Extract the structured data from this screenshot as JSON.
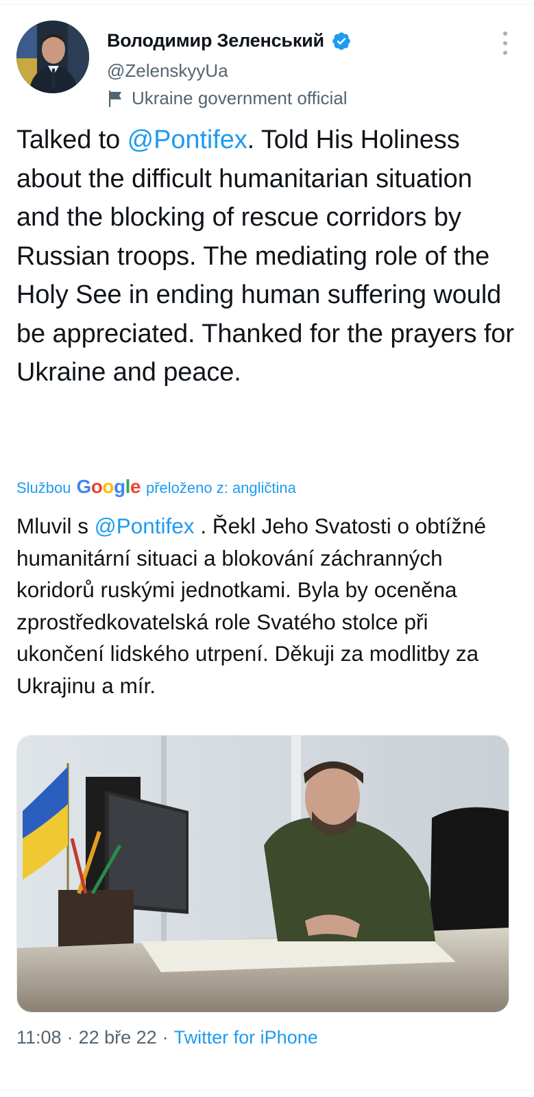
{
  "author": {
    "display_name": "Володимир Зеленський",
    "handle": "@ZelenskyyUa",
    "label": "Ukraine government official",
    "verified": true
  },
  "icons": {
    "verified": "verified-badge-icon",
    "label": "flag-icon",
    "more": "more-vertical-icon"
  },
  "tweet": {
    "prefix": "Talked to ",
    "mention": "@Pontifex",
    "body": ". Told His Holiness about the difficult humanitarian situation and the blocking of rescue corridors by Russian troops. The mediating role of the Holy See in ending human suffering would be appreciated. Thanked for the prayers for Ukraine and peace."
  },
  "translation": {
    "by_label": "Službou",
    "provider": "Google",
    "from_label": "přeloženo z: angličtina",
    "prefix": "Mluvil s ",
    "mention": "@Pontifex",
    "body": " . Řekl Jeho Svatosti o obtížné humanitární situaci a blokování záchranných koridorů ruskými jednotkami. Byla by oceněna zprostředkovatelská role Svatého stolce při ukončení lidského utrpení. Děkuji za modlitby za Ukrajinu a mír."
  },
  "meta": {
    "time": "11:08",
    "sep1": "·",
    "date": "22 bře 22",
    "sep2": "·",
    "source": "Twitter for iPhone"
  },
  "colors": {
    "accent": "#1d9bf0",
    "text": "#0f1419",
    "secondary": "#536471"
  }
}
